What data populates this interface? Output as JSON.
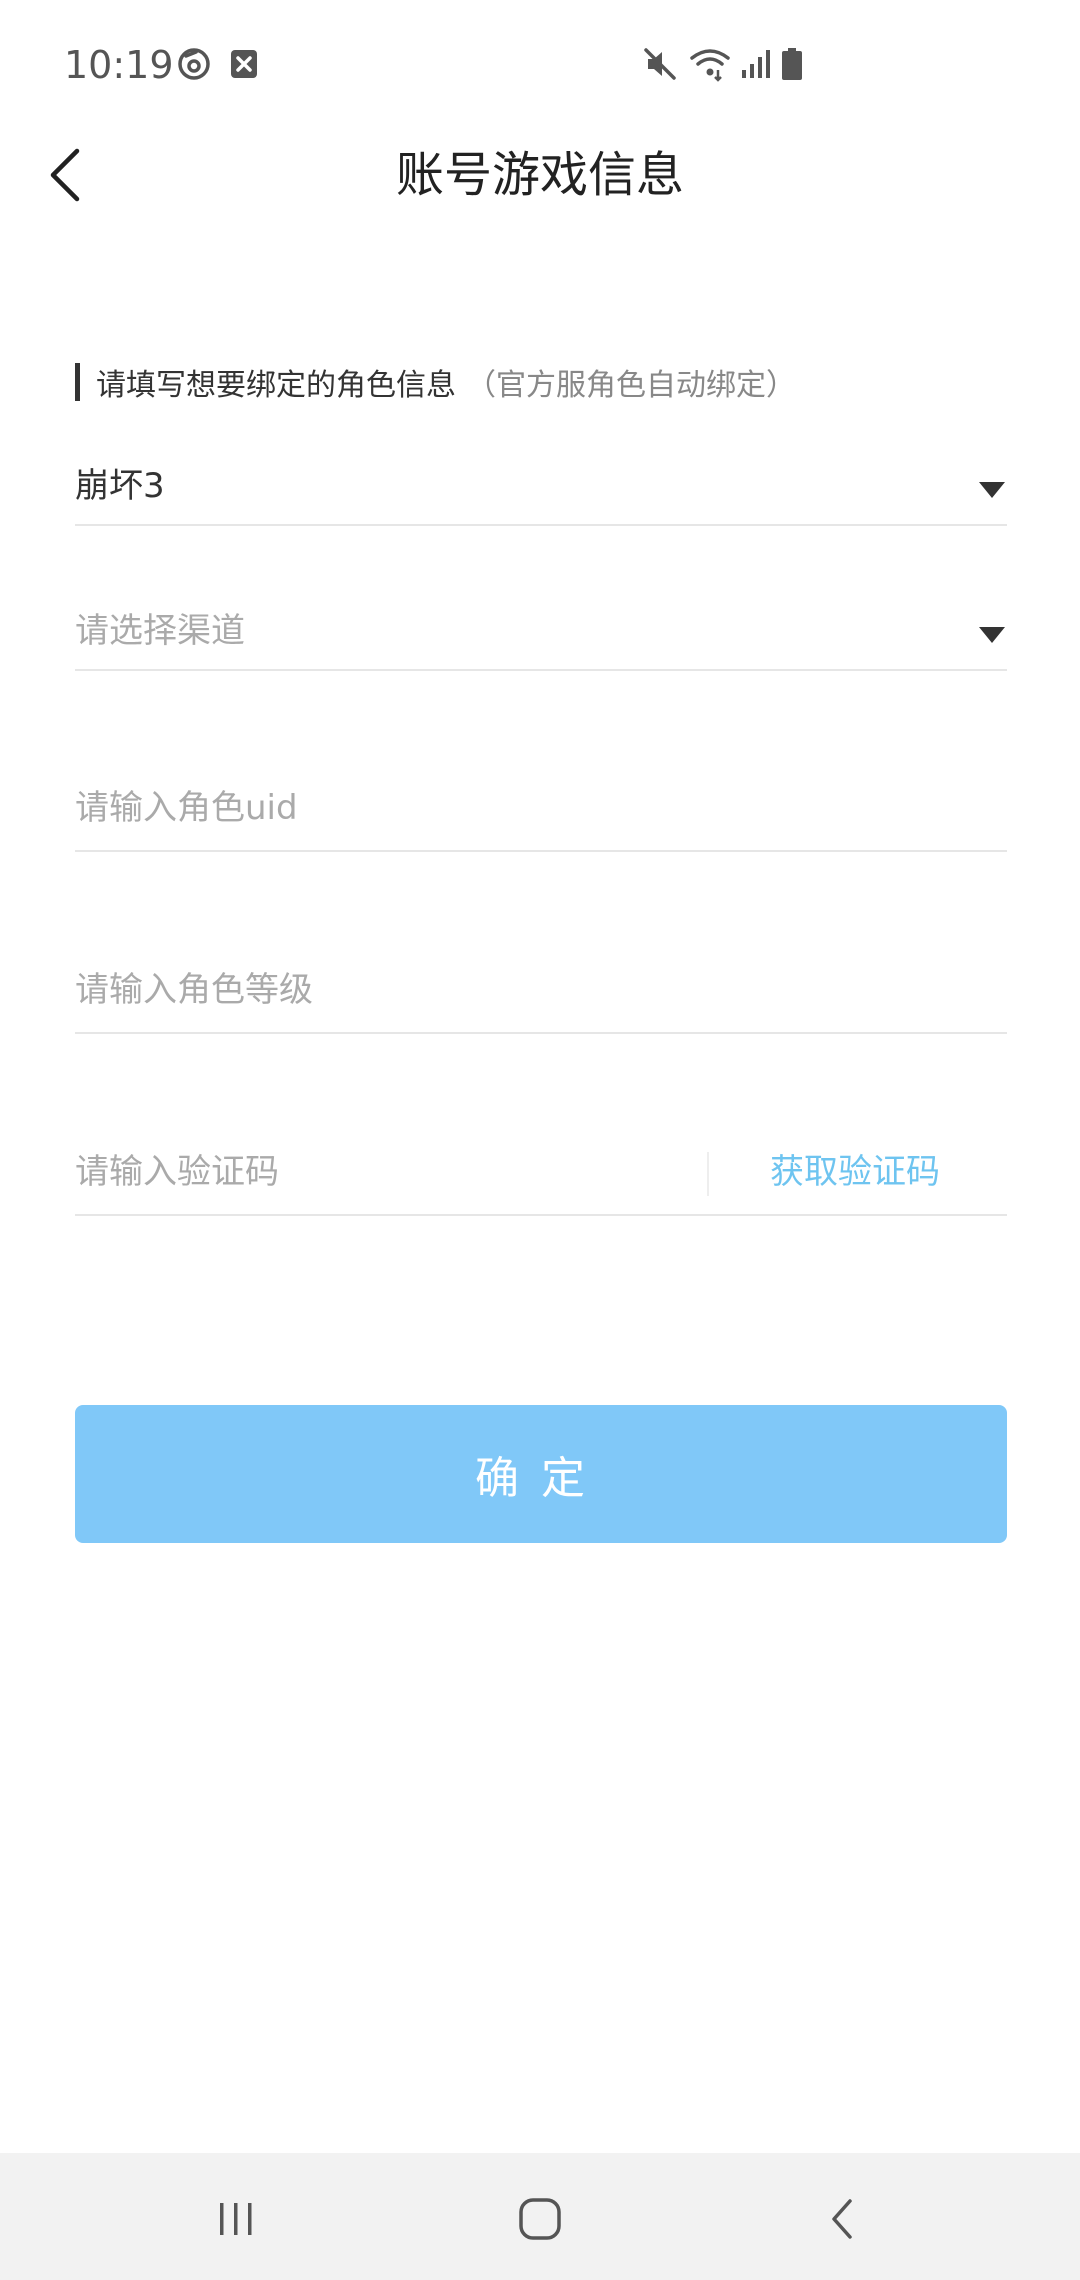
{
  "status_bar": {
    "time": "10:19",
    "left_icons": [
      "netease-icon",
      "notification-close-icon"
    ],
    "right_icons": [
      "mute-icon",
      "wifi-icon",
      "signal-icon",
      "battery-icon"
    ]
  },
  "header": {
    "title": "账号游戏信息",
    "back_icon": "chevron-left-icon"
  },
  "form": {
    "hint_main": "请填写想要绑定的角色信息",
    "hint_sub": "（官方服角色自动绑定）",
    "game_select": {
      "value": "崩坏3",
      "icon": "dropdown-triangle-icon"
    },
    "channel_select": {
      "placeholder": "请选择渠道",
      "icon": "dropdown-triangle-icon"
    },
    "uid_input": {
      "placeholder": "请输入角色uid",
      "value": ""
    },
    "level_input": {
      "placeholder": "请输入角色等级",
      "value": ""
    },
    "code_input": {
      "placeholder": "请输入验证码",
      "value": ""
    },
    "get_code_label": "获取验证码"
  },
  "confirm_label": "确定",
  "nav_bar": {
    "icons": [
      "recent-apps-icon",
      "home-icon",
      "back-icon"
    ]
  },
  "colors": {
    "accent": "#6ec4f0",
    "button_bg": "#80c8f8",
    "nav_bg": "#f2f2f2"
  }
}
